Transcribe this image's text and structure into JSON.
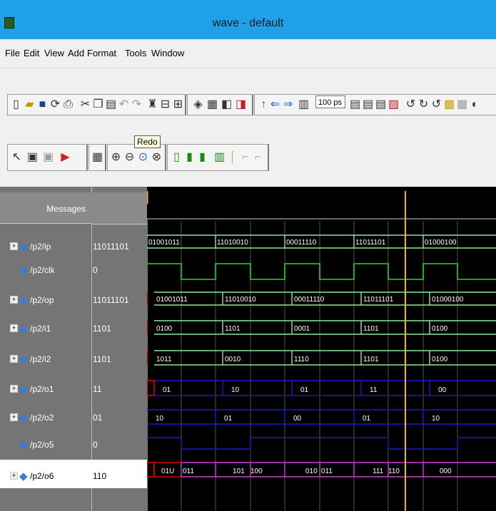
{
  "window": {
    "title": "wave - default"
  },
  "menu": [
    "File",
    "Edit",
    "View",
    "Add",
    "Format",
    "Tools",
    "Window"
  ],
  "toolbar": {
    "time_value": "100",
    "time_unit": "ps",
    "tooltip": "Redo"
  },
  "header": {
    "messages": "Messages"
  },
  "signals": [
    {
      "name": "/p2/ip",
      "value": "11011101",
      "expandable": true
    },
    {
      "name": "/p2/clk",
      "value": "0",
      "expandable": false
    },
    {
      "name": "/p2/op",
      "value": "11011101",
      "expandable": true
    },
    {
      "name": "/p2/i1",
      "value": "1101",
      "expandable": true
    },
    {
      "name": "/p2/i2",
      "value": "1101",
      "expandable": true
    },
    {
      "name": "/p2/o1",
      "value": "11",
      "expandable": true
    },
    {
      "name": "/p2/o2",
      "value": "01",
      "expandable": true
    },
    {
      "name": "/p2/o5",
      "value": "0",
      "expandable": false
    },
    {
      "name": "/p2/o6",
      "value": "110",
      "expandable": true
    }
  ],
  "wave_labels": {
    "ip": [
      "01001011",
      "11010010",
      "00011110",
      "11011101",
      "01000100"
    ],
    "op": [
      "01001011",
      "11010010",
      "00011110",
      "11011101",
      "01000100"
    ],
    "i1": [
      "0100",
      "1101",
      "0001",
      "1101",
      "0100"
    ],
    "i2": [
      "1011",
      "0010",
      "1110",
      "1101",
      "0100"
    ],
    "o1": [
      "01",
      "10",
      "01",
      "11",
      "00"
    ],
    "o2": [
      "10",
      "01",
      "00",
      "01",
      "10"
    ],
    "o6": [
      "01U",
      "011",
      "101",
      "100",
      "010",
      "011",
      "111",
      "110",
      "000"
    ]
  },
  "colors": {
    "bus": "#8ee6a0",
    "clk": "#22dd22",
    "blue": "#1a1acc",
    "magenta": "#d23cd2",
    "cursor": "#e8c000",
    "red": "#dd0000"
  }
}
